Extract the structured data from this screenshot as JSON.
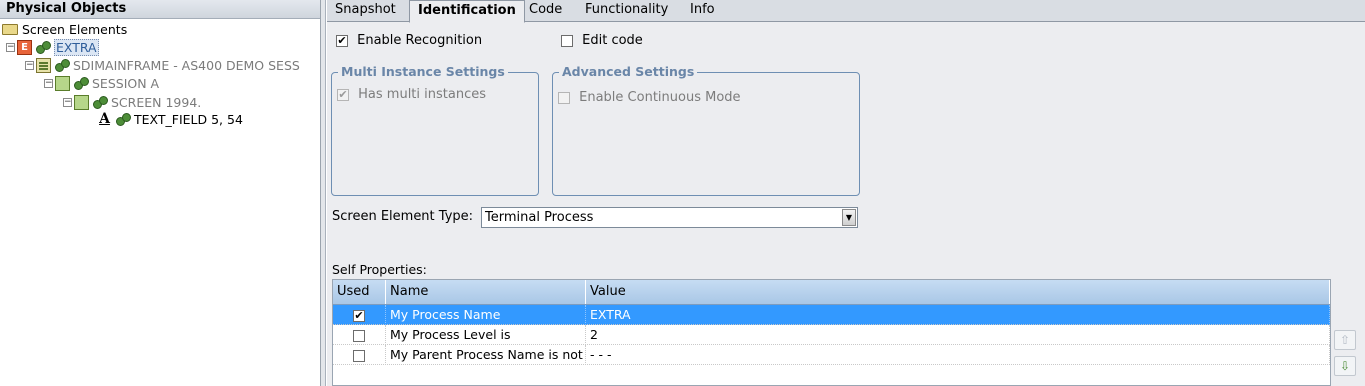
{
  "left_panel": {
    "header": "Physical Objects",
    "tree": {
      "root_label": "Screen Elements",
      "extra_label": "EXTRA",
      "extra_letter": "E",
      "app_label": "SDIMAINFRAME - AS400 DEMO SESS",
      "session_label": "SESSION A",
      "screen_label": "SCREEN 1994.",
      "field_label": "TEXT_FIELD 5, 54",
      "field_letter": "A"
    }
  },
  "tabs": [
    "Snapshot",
    "Identification",
    "Code",
    "Functionality",
    "Info"
  ],
  "active_tab": "Identification",
  "identification": {
    "enable_recognition": {
      "label": "Enable Recognition",
      "checked": true
    },
    "edit_code": {
      "label": "Edit code",
      "checked": false
    },
    "multi_instance": {
      "title": "Multi Instance Settings",
      "has_multi": {
        "label": "Has multi instances",
        "checked": true,
        "enabled": false
      }
    },
    "advanced": {
      "title": "Advanced Settings",
      "continuous": {
        "label": "Enable Continuous Mode",
        "checked": false,
        "enabled": false
      }
    },
    "element_type": {
      "label": "Screen Element Type:",
      "value": "Terminal Process"
    },
    "self_properties": {
      "label": "Self Properties:",
      "columns": [
        "Used",
        "Name",
        "Value"
      ],
      "rows": [
        {
          "used": true,
          "name": "My Process Name",
          "value": "EXTRA",
          "selected": true
        },
        {
          "used": false,
          "name": "My Process Level is",
          "value": "2",
          "selected": false
        },
        {
          "used": false,
          "name": "My Parent Process Name is not",
          "value": "- - -",
          "selected": false
        }
      ]
    }
  },
  "colors": {
    "selection": "#3399ff",
    "group_border": "#6e8fb3",
    "header_gradient_top": "#c6dcf3"
  },
  "icons": {
    "checkmark": "✔",
    "dropdown": "▼",
    "move_up": "⇧",
    "move_down": "⇩"
  }
}
